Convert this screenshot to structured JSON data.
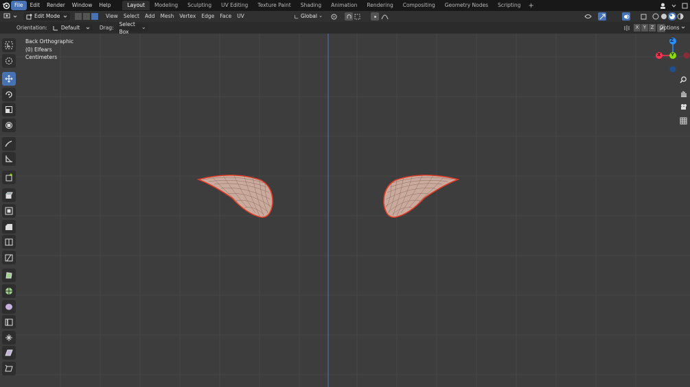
{
  "top_menu": {
    "items": [
      "File",
      "Edit",
      "Render",
      "Window",
      "Help"
    ],
    "active": "File"
  },
  "workspaces": {
    "tabs": [
      "Layout",
      "Modeling",
      "Sculpting",
      "UV Editing",
      "Texture Paint",
      "Shading",
      "Animation",
      "Rendering",
      "Compositing",
      "Geometry Nodes",
      "Scripting"
    ],
    "active": "Layout",
    "add_label": "+"
  },
  "header": {
    "mode": "Edit Mode",
    "menus": [
      "View",
      "Select",
      "Add",
      "Mesh",
      "Vertex",
      "Edge",
      "Face",
      "UV"
    ],
    "transform_orientation": "Global"
  },
  "tool_settings": {
    "orientation_label": "Orientation:",
    "orientation_value": "Default",
    "drag_label": "Drag:",
    "drag_value": "Select Box",
    "axes": [
      "X",
      "Y",
      "Z"
    ],
    "options_label": "Options"
  },
  "viewport": {
    "view_name": "Back Orthographic",
    "object_name": "(0) Elfears",
    "units": "Centimeters"
  },
  "gizmo": {
    "z_label": "Z",
    "y_label": "Y",
    "x_label": "X",
    "colors": {
      "x": "#ff3352",
      "y": "#8bdc00",
      "z": "#2890ff"
    }
  },
  "colors": {
    "accent": "#4772b3",
    "mesh_edge": "#e03c28",
    "mesh_face": "#c8a898",
    "z_axis_line": "#4c78c4"
  }
}
